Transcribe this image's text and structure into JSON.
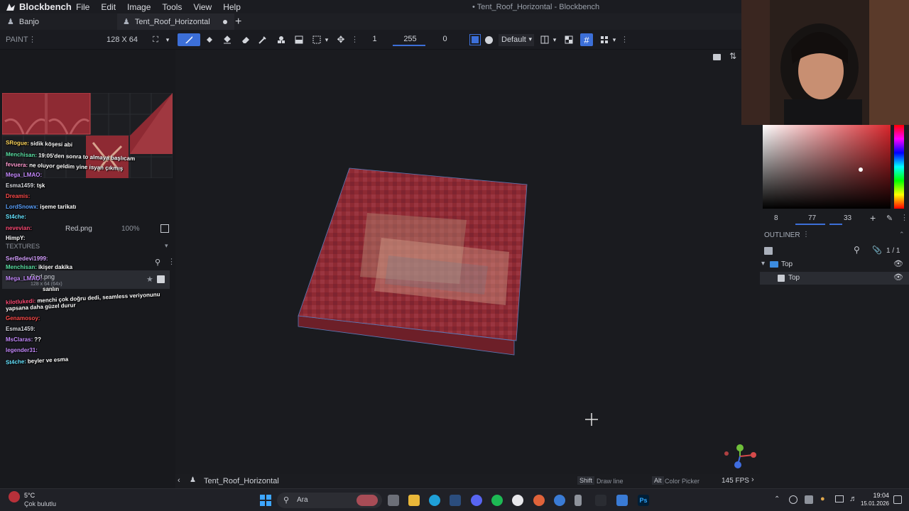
{
  "app": {
    "name": "Blockbench",
    "window_title": "• Tent_Roof_Horizontal - Blockbench",
    "menu": [
      "File",
      "Edit",
      "Image",
      "Tools",
      "View",
      "Help"
    ]
  },
  "tabs": {
    "project": "Banjo",
    "file": "Tent_Roof_Horizontal"
  },
  "toolbar": {
    "mode": "PAINT",
    "canvas_size": "128 X 64",
    "brush_size": "1",
    "opacity": "255",
    "softness": "0",
    "blend_mode": "Default"
  },
  "texture_panel": {
    "file_name": "Red.png",
    "zoom": "100%",
    "section_title": "TEXTURES",
    "item_name": "Red.png",
    "item_meta": "128 x 64 (64x)"
  },
  "chat": [
    {
      "user": "SRogue:",
      "msg": "sidik köşesi abi",
      "color": "#ffd65c"
    },
    {
      "user": "Menchisan:",
      "msg": "19:05'den sonra to almaya başlıcam",
      "color": "#5ce1a5"
    },
    {
      "user": "fevuera:",
      "msg": "ne oluyor geldim yine isyan çıkmış",
      "color": "#ff9ad0"
    },
    {
      "user": "Mega_LMAO:",
      "msg": "",
      "color": "#c68bff"
    },
    {
      "user": "Esma1459:",
      "msg": "tşk",
      "color": "#d6d8de"
    },
    {
      "user": "Dreamis:",
      "msg": "",
      "color": "#ff4c4c"
    },
    {
      "user": "LordSnowx:",
      "msg": "işeme tarikatı",
      "color": "#5da3ff"
    },
    {
      "user": "St4che:",
      "msg": "",
      "color": "#66e3ff"
    },
    {
      "user": "nevevian:",
      "msg": "",
      "color": "#ff4c77"
    },
    {
      "user": "HimpY:",
      "msg": "",
      "color": "#ffffff"
    },
    {
      "user": "SerBedevi1999:",
      "msg": "",
      "color": "#d4a0ff"
    },
    {
      "user": "Menchisan:",
      "msg": "ikişer dakika",
      "color": "#5ce1a5"
    },
    {
      "user": "Mega_LMAO:",
      "msg": "",
      "color": "#c68bff"
    },
    {
      "user": "",
      "msg": "sanlın",
      "color": "#ff4c77"
    },
    {
      "user": "kilotlukedi:",
      "msg": "menchi çok doğru dedi, seamless veriyonunu",
      "color": "#ff4c77"
    },
    {
      "user": "",
      "msg": "yapsana daha güzel durur",
      "color": "#ffffff"
    },
    {
      "user": "Genamosoy:",
      "msg": "",
      "color": "#ff4c4c"
    },
    {
      "user": "Esma1459:",
      "msg": "",
      "color": "#d6d8de"
    },
    {
      "user": "MsClaras:",
      "msg": "??",
      "color": "#c68bff"
    },
    {
      "user": "legender31:",
      "msg": "",
      "color": "#c68bff"
    },
    {
      "user": "St4che:",
      "msg": "beyler ve esma",
      "color": "#66e3ff"
    }
  ],
  "color_picker": {
    "h": "8",
    "s": "77",
    "v": "33",
    "current_color": "#a8302f"
  },
  "outliner": {
    "title": "OUTLINER",
    "count": "1 / 1",
    "group": "Top",
    "cube": "Top"
  },
  "statusbar": {
    "model_name": "Tent_Roof_Horizontal",
    "hint1_key": "Shift",
    "hint1_text": "Draw line",
    "hint2_key": "Alt",
    "hint2_text": "Color Picker",
    "fps": "145 FPS"
  },
  "taskbar": {
    "weather_temp": "5°C",
    "weather_desc": "Çok bulutlu",
    "search_label": "Ara",
    "time": "19:04",
    "date": "15.01.2026"
  },
  "colors": {
    "accent": "#3c6fd8",
    "texture_red": "#8e2a33"
  }
}
